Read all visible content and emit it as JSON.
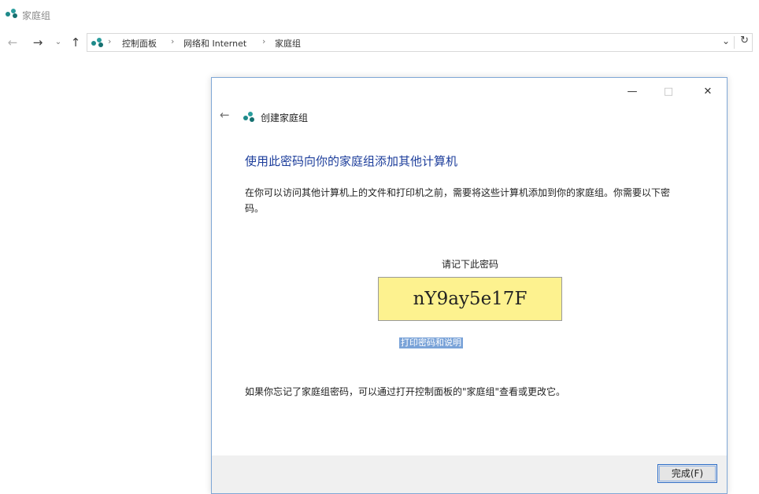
{
  "window": {
    "title": "家庭组"
  },
  "nav": {
    "back_icon": "back-arrow-icon",
    "forward_icon": "forward-arrow-icon",
    "recent_icon": "recent-dropdown-icon",
    "up_icon": "up-arrow-icon"
  },
  "address": {
    "separator": "›",
    "crumbs": [
      "控制面板",
      "网络和 Internet",
      "家庭组"
    ],
    "dropdown_glyph": "⌄",
    "refresh_glyph": "↻"
  },
  "dialog": {
    "title": "创建家庭组",
    "controls": {
      "minimize": "—",
      "maximize": "□",
      "close": "✕"
    },
    "back_glyph": "←",
    "heading": "使用此密码向你的家庭组添加其他计算机",
    "description": "在你可以访问其他计算机上的文件和打印机之前，需要将这些计算机添加到你的家庭组。你需要以下密码。",
    "password_label": "请记下此密码",
    "password": "nY9ay5e17F",
    "print_link": "打印密码和说明",
    "footnote": "如果你忘记了家庭组密码，可以通过打开控制面板的\"家庭组\"查看或更改它。",
    "finish_button": "完成(F)"
  },
  "colors": {
    "accent": "#1c3d9b",
    "password_bg": "#fdf28f",
    "dialog_border": "#7fa7d6",
    "footer_bg": "#f0f0f0",
    "icon_teal": "#1e8a8a"
  }
}
